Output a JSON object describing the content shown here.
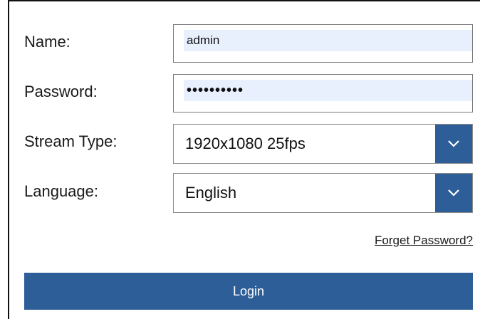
{
  "form": {
    "name_label": "Name:",
    "name_value": "admin",
    "password_label": "Password:",
    "password_value": "••••••••••",
    "stream_type_label": "Stream Type:",
    "stream_type_value": "1920x1080 25fps",
    "language_label": "Language:",
    "language_value": "English",
    "forgot_password_label": "Forget Password?",
    "login_label": "Login"
  },
  "colors": {
    "accent": "#2e5e98",
    "input_fill": "#e9f0fd"
  },
  "icons": {
    "dropdown": "chevron-down-icon"
  }
}
